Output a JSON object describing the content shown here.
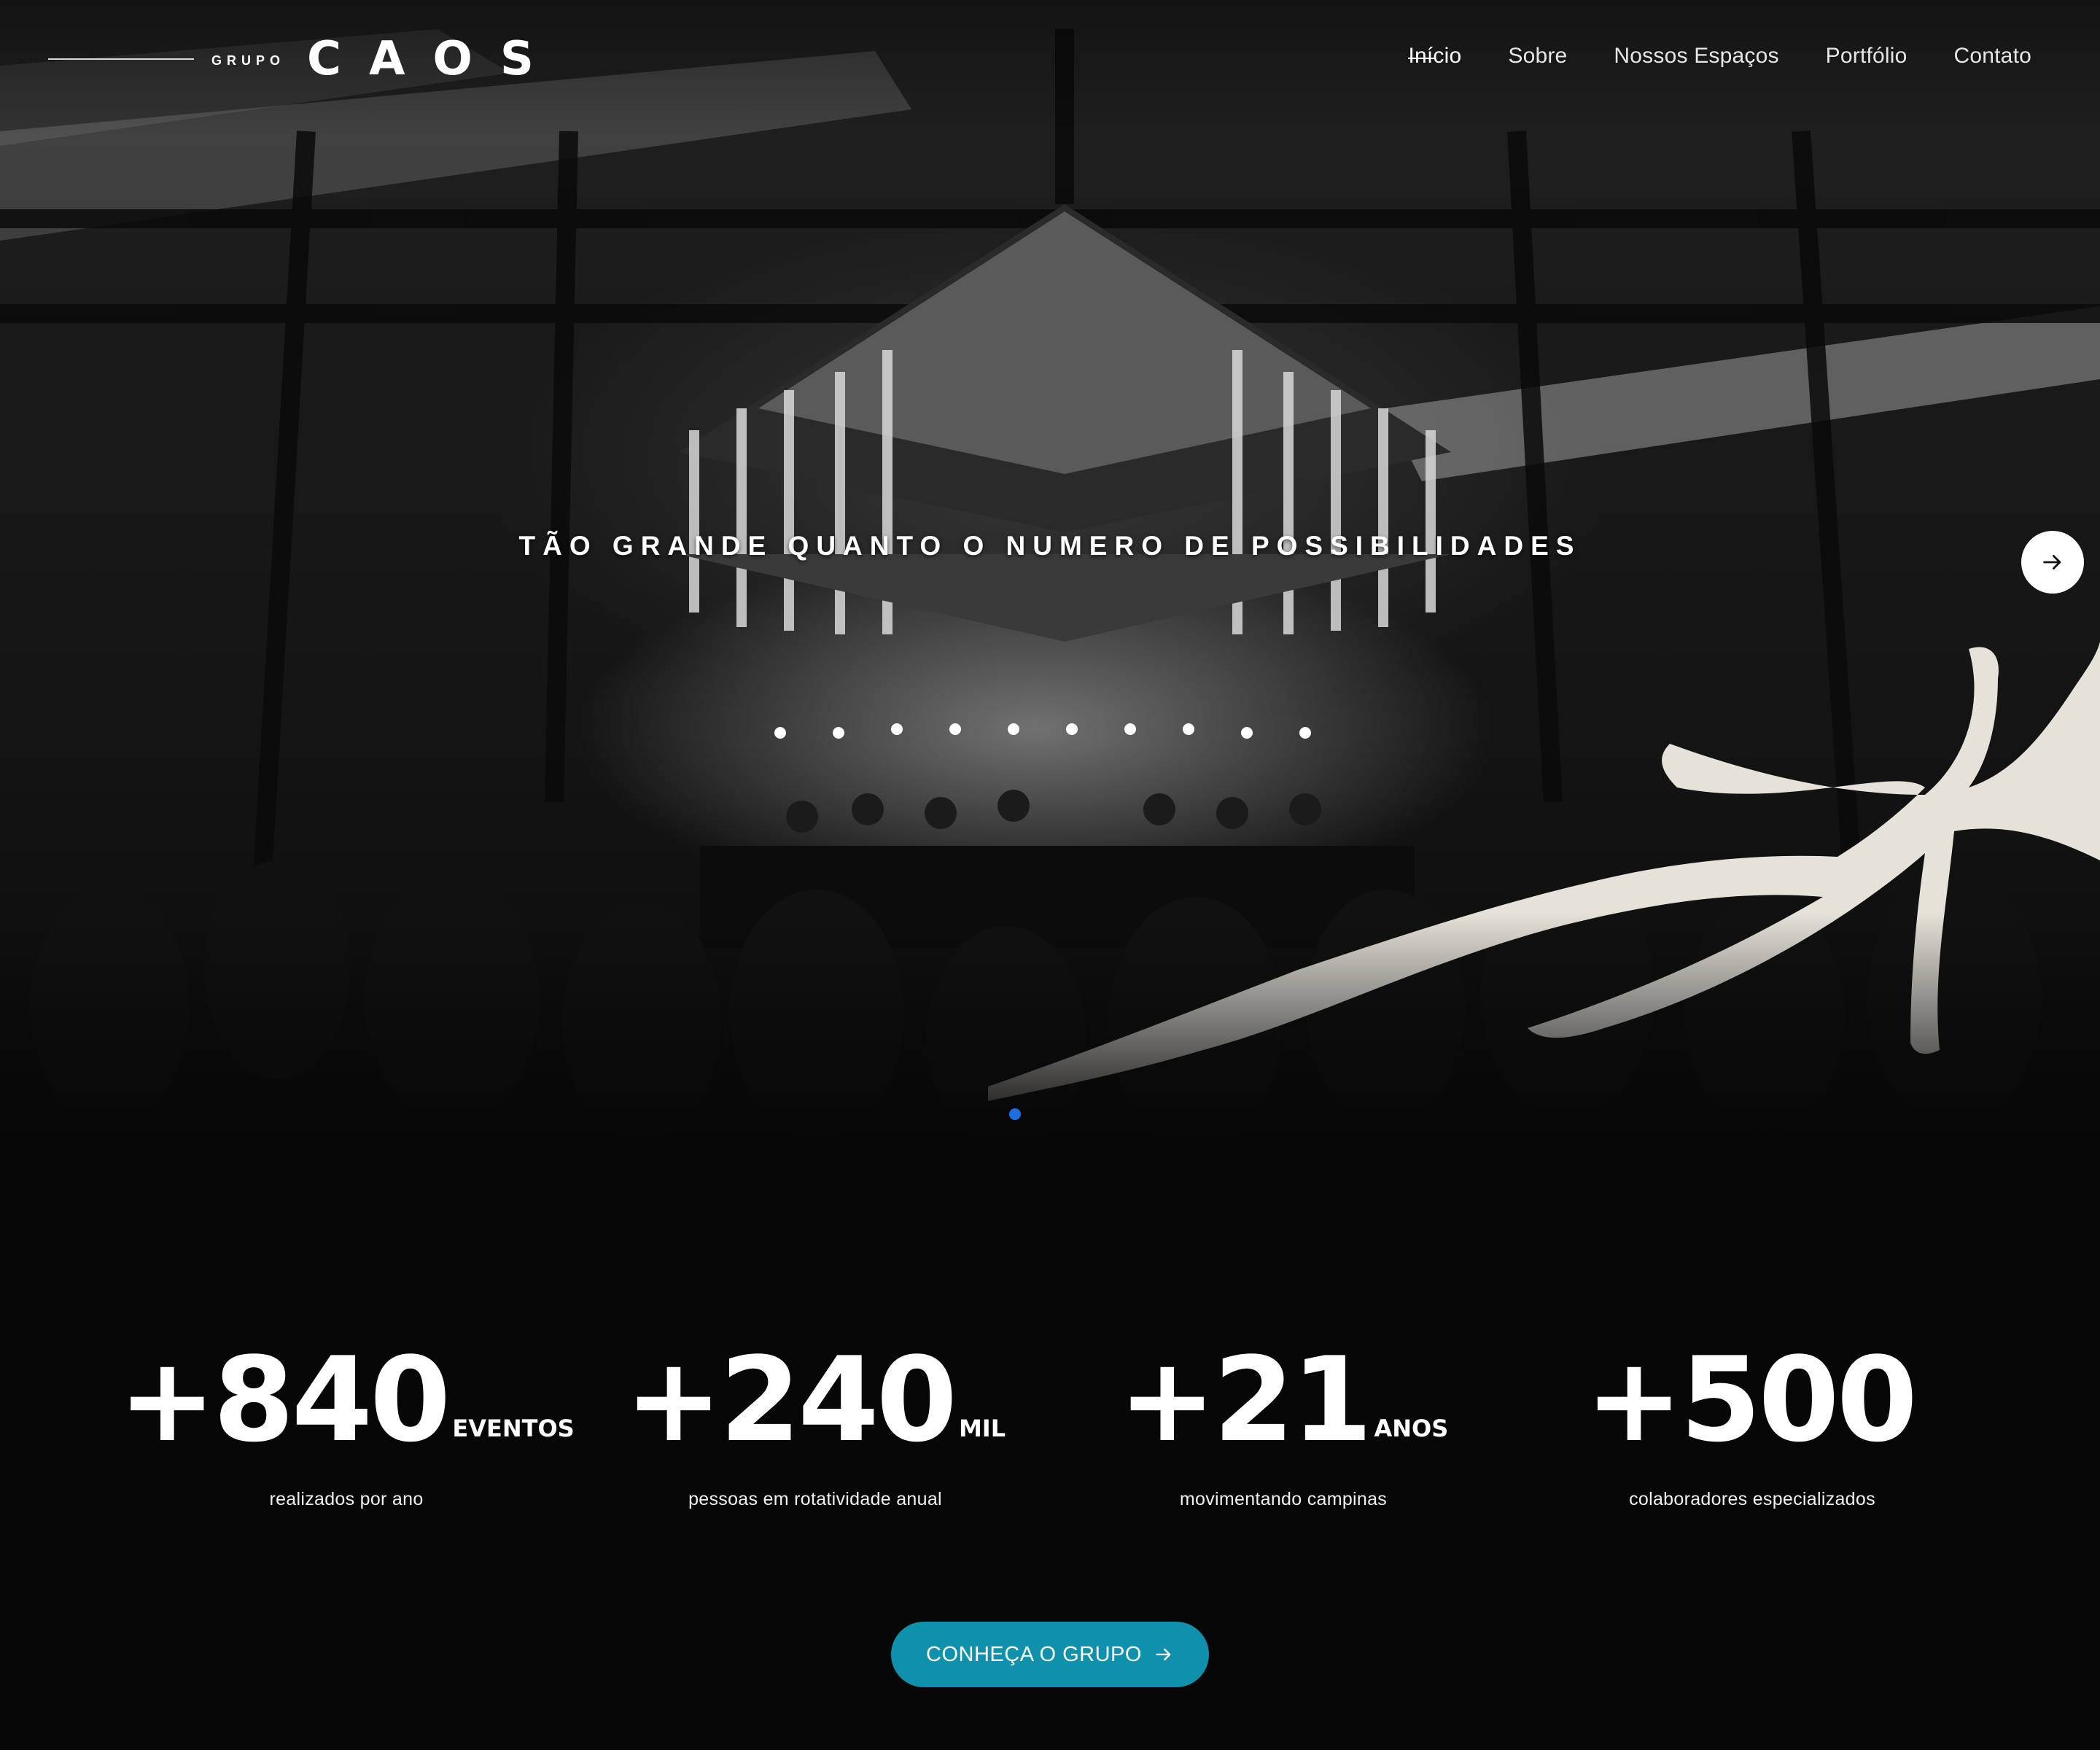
{
  "header": {
    "logo_small": "GRUPO",
    "logo_big": "CAOS",
    "nav": [
      {
        "label": "Início",
        "active": true
      },
      {
        "label": "Sobre",
        "active": false
      },
      {
        "label": "Nossos Espaços",
        "active": false
      },
      {
        "label": "Portfólio",
        "active": false
      },
      {
        "label": "Contato",
        "active": false
      }
    ]
  },
  "hero": {
    "tagline": "TÃO GRANDE QUANTO O NUMERO DE POSSIBILIDADES",
    "next_icon": "arrow-right-icon",
    "slide_count_visible": 1,
    "dot_color": "#1e6fe0"
  },
  "stats": [
    {
      "value": "+840",
      "unit": "EVENTOS",
      "caption": "realizados por ano"
    },
    {
      "value": "+240",
      "unit": "MIL",
      "caption": "pessoas em rotatividade anual"
    },
    {
      "value": "+21",
      "unit": "ANOS",
      "caption": "movimentando campinas"
    },
    {
      "value": "+500",
      "unit": "",
      "caption": "colaboradores especializados"
    }
  ],
  "cta": {
    "label": "CONHEÇA O GRUPO",
    "icon": "arrow-right-icon",
    "color": "#0f91ad"
  },
  "colors": {
    "background": "#070707",
    "accent_art": "#e6e2da"
  }
}
